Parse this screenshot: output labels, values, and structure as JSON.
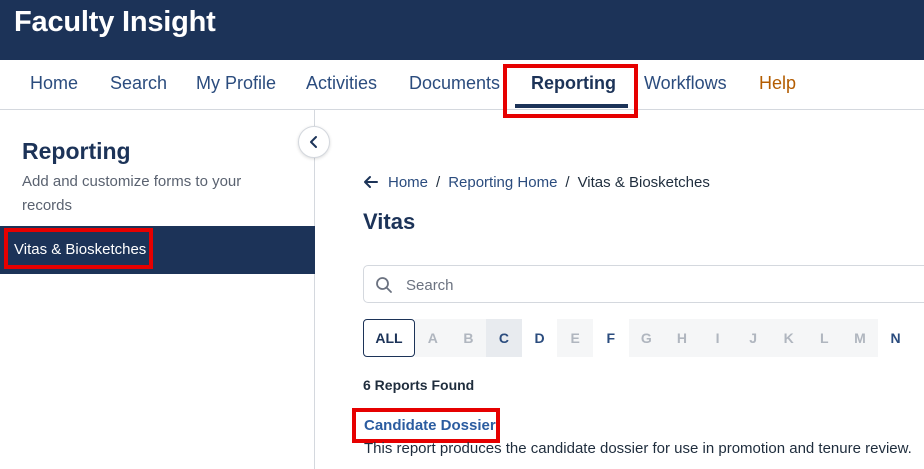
{
  "app": {
    "title": "Faculty Insight"
  },
  "nav": {
    "items": [
      {
        "label": "Home"
      },
      {
        "label": "Search"
      },
      {
        "label": "My Profile"
      },
      {
        "label": "Activities"
      },
      {
        "label": "Documents"
      },
      {
        "label": "Reporting",
        "active": true
      },
      {
        "label": "Workflows"
      },
      {
        "label": "Help"
      }
    ]
  },
  "sidebar": {
    "title": "Reporting",
    "description": "Add and customize forms to your records",
    "items": [
      {
        "label": "Vitas & Biosketches",
        "selected": true
      }
    ]
  },
  "breadcrumb": {
    "items": [
      {
        "label": "Home"
      },
      {
        "label": "Reporting Home"
      },
      {
        "label": "Vitas & Biosketches"
      }
    ],
    "separator": "/"
  },
  "main": {
    "title": "Vitas",
    "search": {
      "placeholder": "Search",
      "value": ""
    },
    "letters": [
      "ALL",
      "A",
      "B",
      "C",
      "D",
      "E",
      "F",
      "G",
      "H",
      "I",
      "J",
      "K",
      "L",
      "M",
      "N"
    ],
    "enabled_letters": [
      "ALL",
      "C",
      "D",
      "F",
      "N"
    ],
    "selected_letter": "C",
    "results_count": "6 Reports Found",
    "reports": [
      {
        "title": "Candidate Dossier",
        "description": "This report produces the candidate dossier for use in promotion and tenure review."
      }
    ]
  },
  "colors": {
    "header_bg": "#1c3358",
    "link": "#2b4c7e",
    "help": "#b35c00",
    "highlight": "#e60000"
  },
  "icons": {
    "collapse": "chevron-left-icon",
    "back": "arrow-left-icon",
    "search": "search-icon"
  }
}
